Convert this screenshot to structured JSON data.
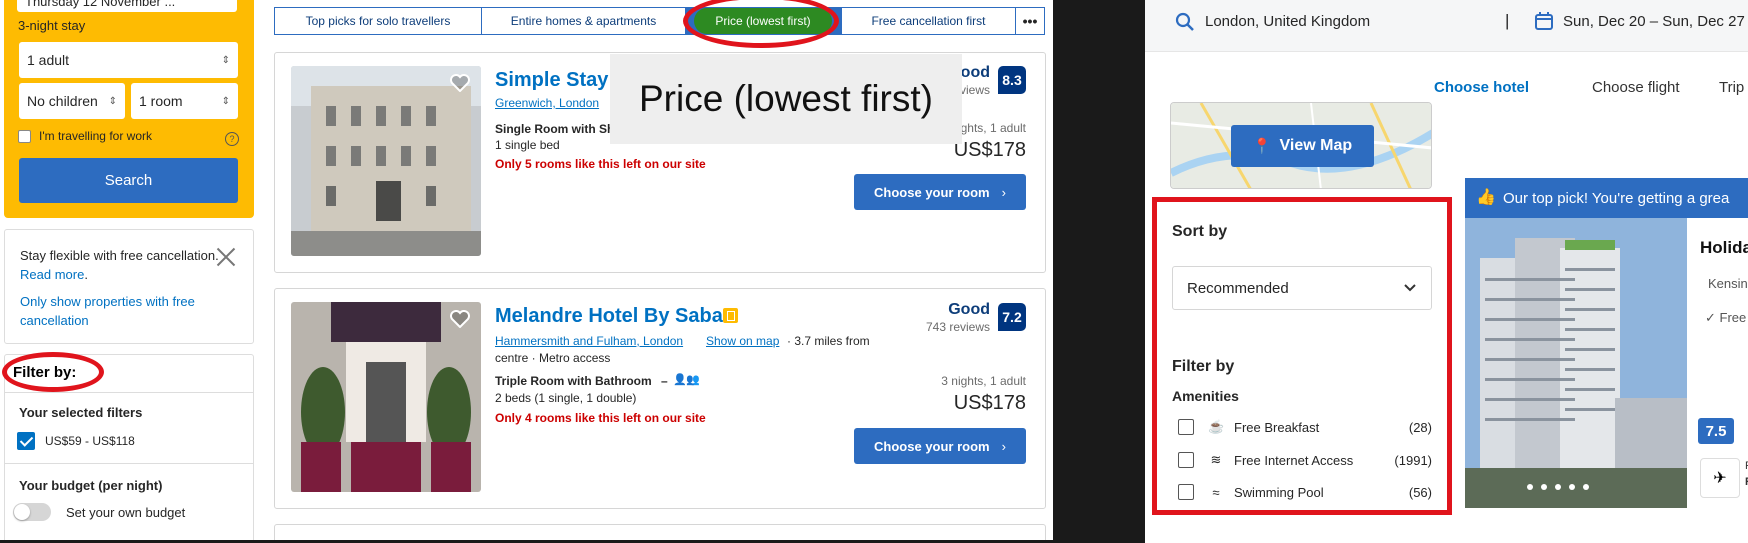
{
  "left": {
    "sidebar": {
      "checkin_date": "Thursday 12 November ...",
      "stay_length": "3-night stay",
      "adults": "1 adult",
      "children": "No children",
      "rooms": "1 room",
      "work_travel_label": "I'm travelling for work",
      "search_label": "Search",
      "flexible_text": "Stay flexible with free cancellation.",
      "read_more": "Read more",
      "read_more_dot": ".",
      "only_free_link": "Only show properties with free cancellation",
      "filter_by": "Filter by:",
      "selected_filters": "Your selected filters",
      "price_filter": "US$59 - US$118",
      "budget_heading": "Your budget (per night)",
      "own_budget": "Set your own budget"
    },
    "tabs": [
      {
        "label": "Top picks for solo travellers"
      },
      {
        "label": "Entire homes & apartments"
      },
      {
        "label": "Price (lowest first)"
      },
      {
        "label": "Free cancellation first"
      },
      {
        "label": "•••"
      }
    ],
    "callout": "Price (lowest first)",
    "cards": [
      {
        "name": "Simple Stay",
        "location": "Greenwich, London",
        "room": "Single Room with Sh",
        "beds": "1 single bed",
        "scarcity": "Only 5 rooms like this left on our site",
        "rating_word": "ood",
        "reviews": "views",
        "score": "8.3",
        "stay": "3 nights, 1 adult",
        "price": "US$178",
        "button": "Choose your room",
        "chevron": "›"
      },
      {
        "name": "Melandre Hotel By Saba",
        "location": "Hammersmith and Fulham, London",
        "map_link": "Show on map",
        "distance": "· 3.7 miles from",
        "distance_line2": "centre · Metro access",
        "room": "Triple Room with Bathroom",
        "room_suffix": "–",
        "beds": "2 beds (1 single, 1 double)",
        "scarcity": "Only 4 rooms like this left on our site",
        "rating_word": "Good",
        "reviews": "743 reviews",
        "score": "7.2",
        "stay": "3 nights, 1 adult",
        "price": "US$178",
        "button": "Choose your room",
        "chevron": "›"
      }
    ]
  },
  "right": {
    "search_location": "London, United Kingdom",
    "separator": "|",
    "dates": "Sun, Dec 20 – Sun, Dec 27",
    "tabs": [
      {
        "label": "Choose hotel",
        "active": true
      },
      {
        "label": "Choose flight",
        "active": false
      },
      {
        "label": "Trip",
        "active": false
      }
    ],
    "view_map": "View Map",
    "sort_by": "Sort by",
    "sort_value": "Recommended",
    "filter_by": "Filter by",
    "amenities_heading": "Amenities",
    "amenities": [
      {
        "label": "Free Breakfast",
        "count": "(28)",
        "icon": "coffee-cup-icon"
      },
      {
        "label": "Free Internet Access",
        "count": "(1991)",
        "icon": "wifi-icon"
      },
      {
        "label": "Swimming Pool",
        "count": "(56)",
        "icon": "swimmer-icon"
      }
    ],
    "top_pick": "Our top pick! You're getting a grea",
    "hotel_title": "Holida",
    "location_snippet": "Kensin",
    "free_snippet": "Free",
    "score": "7.5",
    "snippet_p": "P",
    "snippet_r": "R"
  },
  "colors": {
    "accent_blue": "#2d6cc0",
    "brand_yellow": "#febb02",
    "annotation_red": "#e0141c",
    "active_green": "#2d8a22",
    "scarcity_red": "#cc0000"
  }
}
